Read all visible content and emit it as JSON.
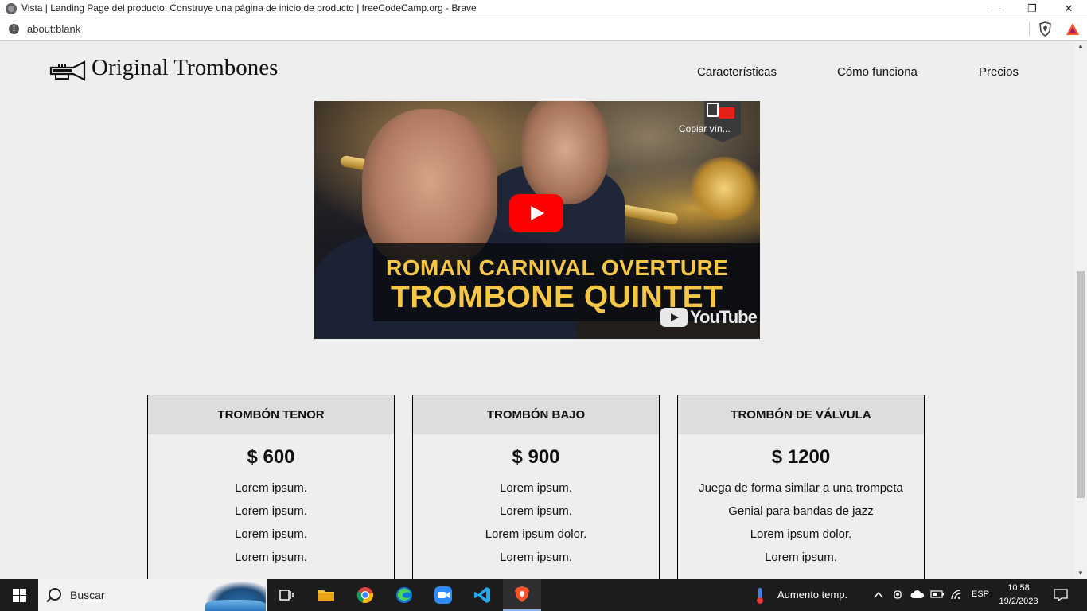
{
  "window": {
    "title": "Vista | Landing Page del producto: Construye una página de inicio de producto | freeCodeCamp.org - Brave",
    "minimize": "—",
    "restore": "❐",
    "close": "✕"
  },
  "addressbar": {
    "url": "about:blank",
    "info_icon": "!"
  },
  "header": {
    "brand": "Original Trombones",
    "nav": [
      {
        "label": "Características"
      },
      {
        "label": "Cómo funciona"
      },
      {
        "label": "Precios"
      }
    ]
  },
  "video": {
    "title_line1": "ROMAN CARNIVAL OVERTURE",
    "title_line2": "TROMBONE QUINTET",
    "copy_label": "Copiar vín...",
    "brand": "YouTube"
  },
  "pricing": [
    {
      "name": "TROMBÓN TENOR",
      "price": "$ 600",
      "features": [
        "Lorem ipsum.",
        "Lorem ipsum.",
        "Lorem ipsum.",
        "Lorem ipsum."
      ]
    },
    {
      "name": "TROMBÓN BAJO",
      "price": "$ 900",
      "features": [
        "Lorem ipsum.",
        "Lorem ipsum.",
        "Lorem ipsum dolor.",
        "Lorem ipsum."
      ]
    },
    {
      "name": "TROMBÓN DE VÁLVULA",
      "price": "$ 1200",
      "features": [
        "Juega de forma similar a una trompeta",
        "Genial para bandas de jazz",
        "Lorem ipsum dolor.",
        "Lorem ipsum."
      ]
    }
  ],
  "taskbar": {
    "search_placeholder": "Buscar",
    "weather": "Aumento temp.",
    "language": "ESP",
    "time": "10:58",
    "date": "19/2/2023"
  },
  "scrollbar": {
    "up": "▲",
    "down": "▼"
  }
}
